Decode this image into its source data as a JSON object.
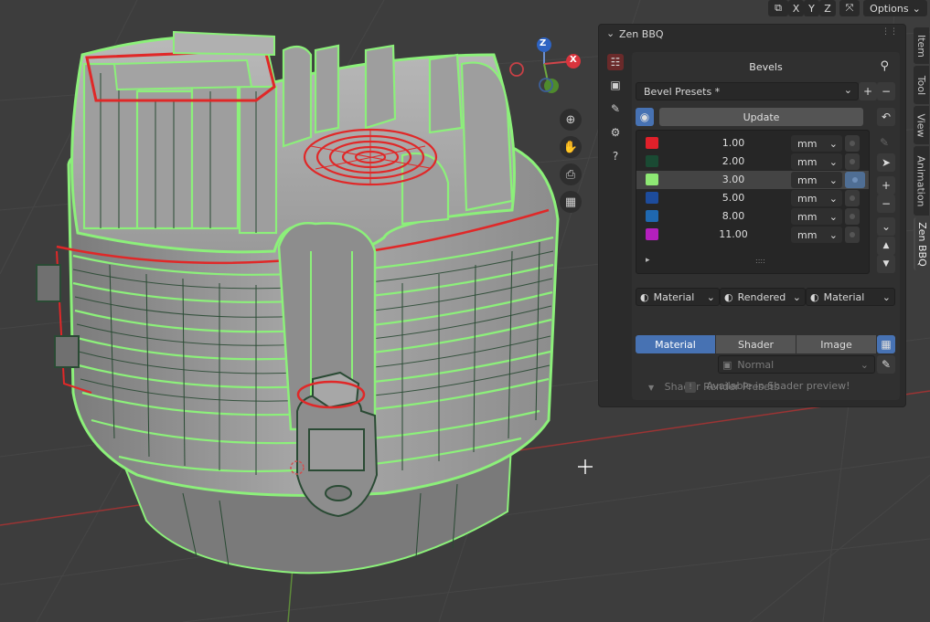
{
  "header": {
    "axis_labels": [
      "X",
      "Y",
      "Z"
    ],
    "options_label": "Options",
    "options_chevron": "⌄"
  },
  "gizmo": {
    "z_label": "Z",
    "x_label": "X"
  },
  "panel": {
    "title": "Zen BBQ",
    "subpanel_title": "Bevels",
    "presets_label": "Bevel Presets *",
    "add_label": "+",
    "remove_label": "−",
    "update_label": "Update",
    "bevels": [
      {
        "value": "1.00",
        "unit": "mm",
        "color": "#e0202a"
      },
      {
        "value": "2.00",
        "unit": "mm",
        "color": "#1a4a33"
      },
      {
        "value": "3.00",
        "unit": "mm",
        "color": "#8ee874"
      },
      {
        "value": "5.00",
        "unit": "mm",
        "color": "#1d4c9c"
      },
      {
        "value": "8.00",
        "unit": "mm",
        "color": "#1f68b0"
      },
      {
        "value": "11.00",
        "unit": "mm",
        "color": "#b41fbd"
      }
    ],
    "selected_index": 2,
    "list_expand": "▸",
    "list_grip": "::::",
    "side_add": "+",
    "side_remove": "−",
    "side_expand": "⌄",
    "side_up": "▲",
    "side_down": "▼",
    "shading": {
      "left": "Material",
      "middle": "Rendered",
      "right": "Material"
    },
    "tabs": [
      "Material",
      "Shader",
      "Image"
    ],
    "active_tab": "Material",
    "normal_label": "Normal",
    "shader_presets_label": "Shader Render Presets",
    "info_text": "Available in Shader preview!"
  },
  "sidebar_tabs": [
    "Item",
    "Tool",
    "View",
    "Animation",
    "Zen BBQ"
  ],
  "active_sidebar_tab": "Zen BBQ",
  "colors": {
    "viewport_bg": "#3d3d3d",
    "wire_green": "#8cf07a",
    "wire_red": "#e02828",
    "accent_blue": "#4772b3"
  },
  "icons": {
    "zoom": "zoom-in-icon",
    "pan": "hand-icon",
    "camera": "camera-icon",
    "grid": "perspective-grid-icon"
  }
}
